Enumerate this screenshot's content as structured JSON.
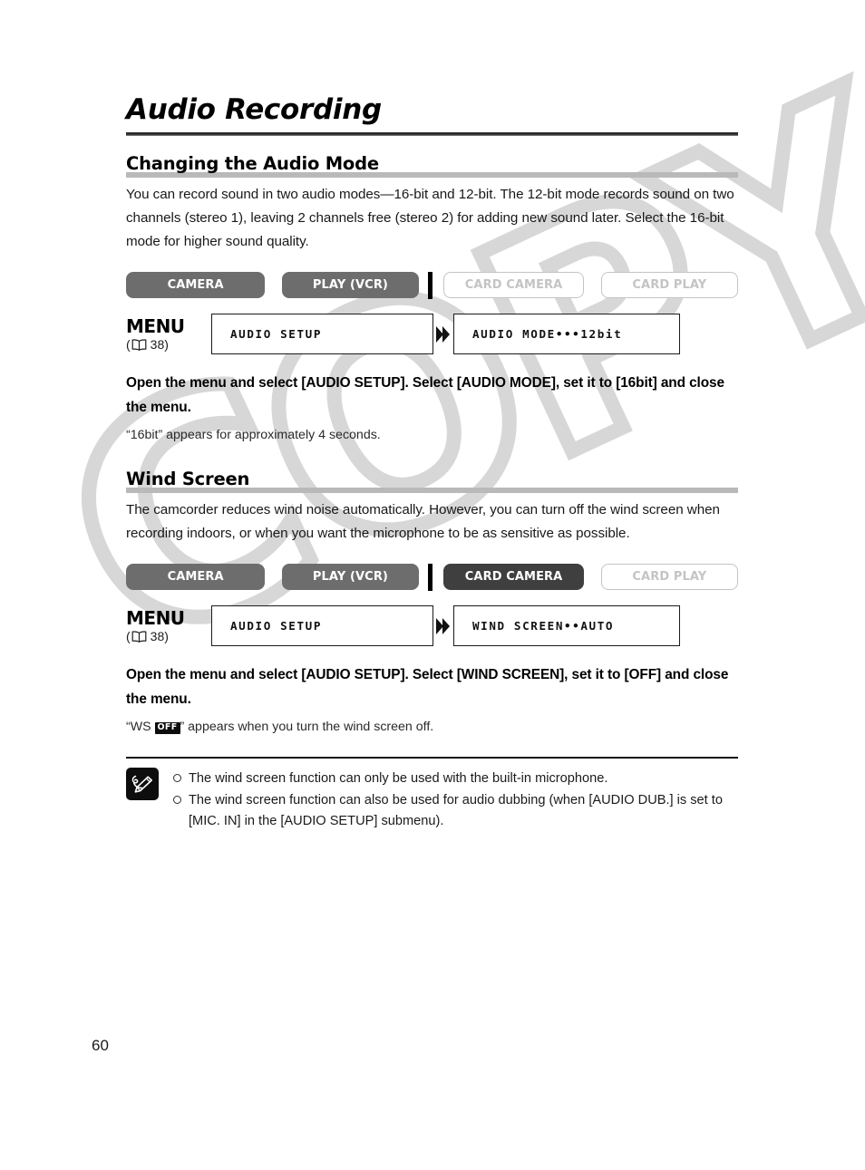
{
  "document": {
    "title": "Audio Recording",
    "page_number": "60",
    "watermark": "COPY"
  },
  "colors": {
    "active_button": "#6d6d6d",
    "active_button_dark": "#3f3f3f",
    "inactive_button_border": "#c4c4c4",
    "inactive_button_text": "#c4c4c4",
    "heading_rule": "#b9b9b9",
    "watermark": "#d7d7d7"
  },
  "sections": [
    {
      "heading": "Changing the Audio Mode",
      "body": "You can record sound in two audio modes—16-bit and 12-bit. The 12-bit mode records sound on two channels (stereo 1), leaving 2 channels free (stereo 2) for adding new sound later. Select the 16-bit mode for higher sound quality.",
      "modes": [
        {
          "label": "CAMERA",
          "state": "active"
        },
        {
          "label": "PLAY (VCR)",
          "state": "active"
        },
        {
          "label": "CARD CAMERA",
          "state": "inactive"
        },
        {
          "label": "CARD PLAY",
          "state": "inactive"
        }
      ],
      "menu": {
        "label": "MENU",
        "ref_open": "(",
        "ref_page": "38",
        "ref_close": ")",
        "box_left": "AUDIO SETUP",
        "box_right": "AUDIO MODE•••12bit"
      },
      "instruction": "Open the menu and select [AUDIO SETUP]. Select [AUDIO MODE], set it to [16bit] and close the menu.",
      "sub_note": "“16bit” appears for approximately 4 seconds."
    },
    {
      "heading": "Wind Screen",
      "body": "The camcorder reduces wind noise automatically. However, you can turn off the wind screen when recording indoors, or when you want the microphone to be as sensitive as possible.",
      "modes": [
        {
          "label": "CAMERA",
          "state": "active"
        },
        {
          "label": "PLAY (VCR)",
          "state": "active"
        },
        {
          "label": "CARD CAMERA",
          "state": "active-dark"
        },
        {
          "label": "CARD PLAY",
          "state": "inactive"
        }
      ],
      "menu": {
        "label": "MENU",
        "ref_open": "(",
        "ref_page": "38",
        "ref_close": ")",
        "box_left": "AUDIO SETUP",
        "box_right": "WIND SCREEN••AUTO"
      },
      "instruction": "Open the menu and select [AUDIO SETUP]. Select [WIND SCREEN], set it to [OFF] and close the menu.",
      "sub_note_prefix": "“WS ",
      "sub_note_badge": "OFF",
      "sub_note_suffix": "” appears when you turn the wind screen off."
    }
  ],
  "notes": {
    "items": [
      "The wind screen function can only be used with the built-in microphone.",
      "The wind screen function can also be used for audio dubbing (when [AUDIO DUB.] is set to [MIC. IN] in the [AUDIO SETUP] submenu)."
    ]
  }
}
